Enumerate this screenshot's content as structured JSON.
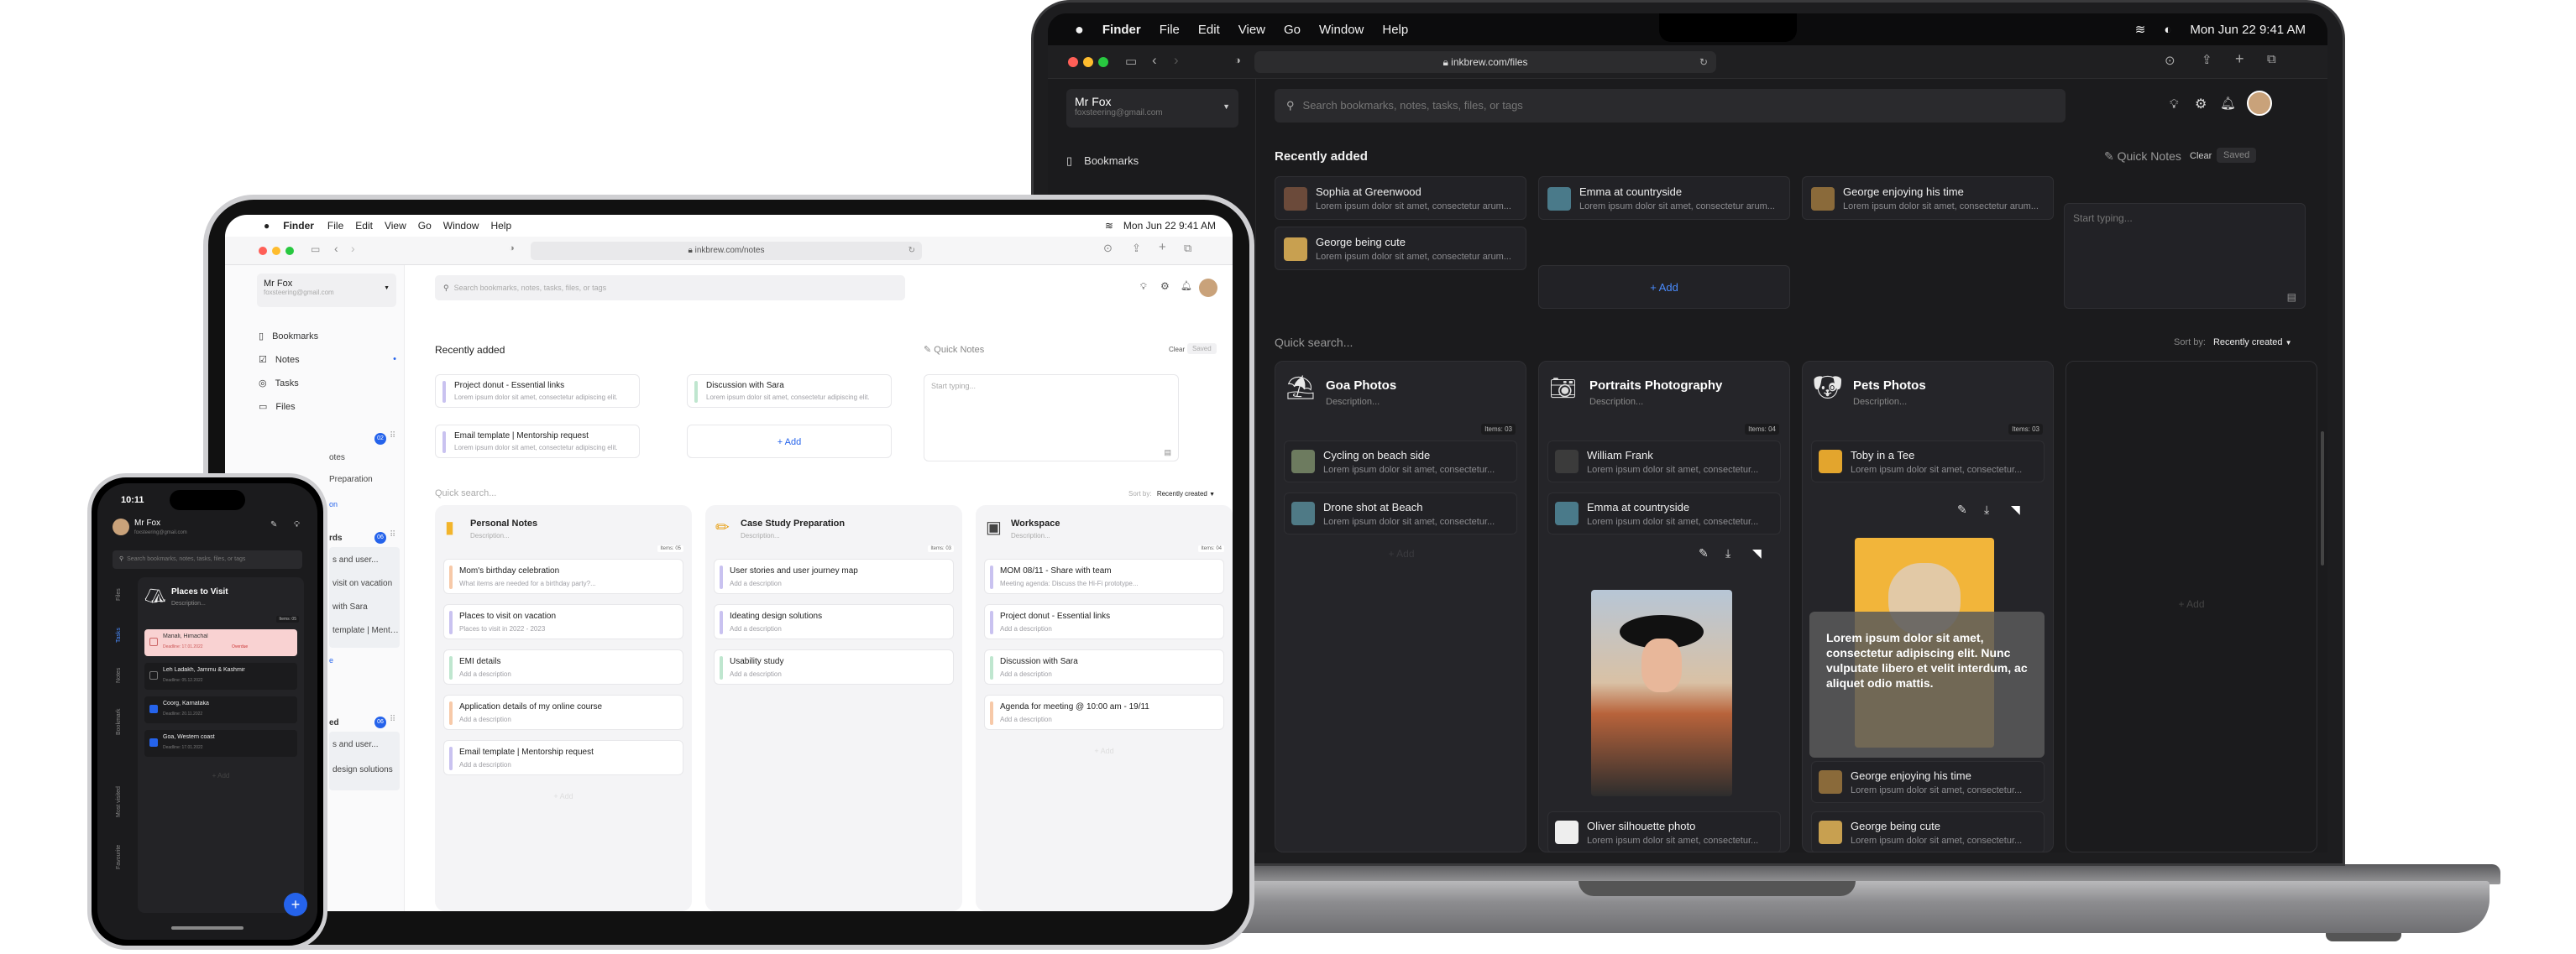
{
  "macbook": {
    "menubar": {
      "finder": "Finder",
      "items": [
        "File",
        "Edit",
        "View",
        "Go",
        "Window",
        "Help"
      ],
      "datetime": "Mon Jun 22  9:41 AM"
    },
    "url": "inkbrew.com/files",
    "user": {
      "name": "Mr Fox",
      "email": "foxsteering@gmail.com"
    },
    "sidebar": {
      "bookmarks": "Bookmarks"
    },
    "search": {
      "placeholder": "Search bookmarks, notes, tasks, files, or tags"
    },
    "recent": {
      "title": "Recently added",
      "items": [
        {
          "title": "Sophia at Greenwood",
          "desc": "Lorem ipsum dolor sit amet, consectetur arum...",
          "color": "#6b4a3a"
        },
        {
          "title": "Emma at countryside",
          "desc": "Lorem ipsum dolor sit amet, consectetur arum...",
          "color": "#4a7a8a"
        },
        {
          "title": "George enjoying his time",
          "desc": "Lorem ipsum dolor sit amet, consectetur arum...",
          "color": "#8a6a3a"
        },
        {
          "title": "George being cute",
          "desc": "Lorem ipsum dolor sit amet, consectetur arum...",
          "color": "#c8a050"
        }
      ],
      "add": "+ Add"
    },
    "quick_notes": {
      "title": "Quick Notes",
      "clear": "Clear",
      "saved": "Saved",
      "placeholder": "Start typing..."
    },
    "quick_search": "Quick search...",
    "sort": {
      "label": "Sort by:",
      "value": "Recently created"
    },
    "collections": [
      {
        "name": "Goa Photos",
        "desc": "Description...",
        "items": "Items: 03",
        "entries": [
          {
            "title": "Cycling on beach side",
            "desc": "Lorem ipsum dolor sit amet, consectetur..."
          },
          {
            "title": "Drone shot at Beach",
            "desc": "Lorem ipsum dolor sit amet, consectetur..."
          }
        ],
        "add": "+ Add"
      },
      {
        "name": "Portraits Photography",
        "desc": "Description...",
        "items": "Items: 04",
        "entries": [
          {
            "title": "William Frank",
            "desc": "Lorem ipsum dolor sit amet, consectetur..."
          },
          {
            "title": "Emma at countryside",
            "desc": "Lorem ipsum dolor sit amet, consectetur..."
          },
          {
            "title": "Oliver silhouette photo",
            "desc": "Lorem ipsum dolor sit amet, consectetur..."
          }
        ]
      },
      {
        "name": "Pets Photos",
        "desc": "Description...",
        "items": "Items: 03",
        "entries": [
          {
            "title": "Toby in a Tee",
            "desc": "Lorem ipsum dolor sit amet, consectetur..."
          },
          {
            "title": "George enjoying his time",
            "desc": "Lorem ipsum dolor sit amet, consectetur..."
          },
          {
            "title": "George being cute",
            "desc": "Lorem ipsum dolor sit amet, consectetur..."
          }
        ],
        "overlay": "Lorem ipsum dolor sit amet, consectetur adipiscing elit. Nunc vulputate libero et velit interdum, ac aliquet odio mattis."
      }
    ],
    "empty_add": "+ Add"
  },
  "ipad": {
    "menubar": {
      "finder": "Finder",
      "items": [
        "File",
        "Edit",
        "View",
        "Go",
        "Window",
        "Help"
      ],
      "datetime": "Mon Jun 22  9:41 AM"
    },
    "url": "inkbrew.com/notes",
    "user": {
      "name": "Mr Fox",
      "email": "foxsteering@gmail.com"
    },
    "sidebar": [
      "Bookmarks",
      "Notes",
      "Tasks",
      "Files"
    ],
    "sidebar_sections": [
      {
        "badge": "02",
        "rows": [
          "otes",
          "Preparation"
        ],
        "link": "on"
      },
      {
        "header": "rds",
        "badge": "06",
        "rows": [
          "s and user...",
          "visit on vacation",
          "with Sara",
          "template | Mentor..."
        ],
        "link": "e"
      },
      {
        "header": "ed",
        "badge": "06",
        "rows": [
          "s and user...",
          "design solutions"
        ]
      }
    ],
    "search": {
      "placeholder": "Search bookmarks, notes, tasks, files, or tags"
    },
    "recent": {
      "title": "Recently added",
      "items": [
        {
          "title": "Project donut - Essential links",
          "desc": "Lorem ipsum dolor sit amet, consectetur adipiscing elit.",
          "color": "#c9c2f0"
        },
        {
          "title": "Discussion with Sara",
          "desc": "Lorem ipsum dolor sit amet, consectetur adipiscing elit.",
          "color": "#bfe6cf"
        },
        {
          "title": "Email template | Mentorship request",
          "desc": "Lorem ipsum dolor sit amet, consectetur adipiscing elit.",
          "color": "#c9c2f0"
        }
      ],
      "add": "+ Add"
    },
    "quick_notes": {
      "title": "Quick Notes",
      "clear": "Clear",
      "saved": "Saved",
      "placeholder": "Start typing..."
    },
    "quick_search": "Quick search...",
    "sort": {
      "label": "Sort by:",
      "value": "Recently created"
    },
    "columns": [
      {
        "name": "Personal Notes",
        "desc": "Description...",
        "items": "Items: 05",
        "entries": [
          {
            "title": "Mom's birthday celebration",
            "desc": "What items are needed for a birthday party?...",
            "color": "#f7c9a8"
          },
          {
            "title": "Places to visit on vacation",
            "desc": "Places to visit in 2022 - 2023",
            "color": "#c9c2f0"
          },
          {
            "title": "EMI details",
            "desc": "Add a description",
            "color": "#bfe6cf"
          },
          {
            "title": "Application details of my online course",
            "desc": "Add a description",
            "color": "#f7c9a8"
          },
          {
            "title": "Email template | Mentorship request",
            "desc": "Add a description",
            "color": "#c9c2f0"
          }
        ],
        "add": "+ Add"
      },
      {
        "name": "Case Study Preparation",
        "desc": "Description...",
        "items": "Items: 03",
        "entries": [
          {
            "title": "User stories and user journey map",
            "desc": "Add a description",
            "color": "#c9c2f0"
          },
          {
            "title": "Ideating design solutions",
            "desc": "Add a description",
            "color": "#c9c2f0"
          },
          {
            "title": "Usability study",
            "desc": "Add a description",
            "color": "#bfe6cf"
          }
        ]
      },
      {
        "name": "Workspace",
        "desc": "Description...",
        "items": "Items: 04",
        "entries": [
          {
            "title": "MOM 08/11 - Share with team",
            "desc": "Meeting agenda: Discuss the Hi-Fi prototype...",
            "color": "#c9c2f0"
          },
          {
            "title": "Project donut - Essential links",
            "desc": "Add a description",
            "color": "#c9c2f0"
          },
          {
            "title": "Discussion with Sara",
            "desc": "Add a description",
            "color": "#bfe6cf"
          },
          {
            "title": "Agenda for meeting @ 10:00 am - 19/11",
            "desc": "Add a description",
            "color": "#f7c9a8"
          }
        ],
        "add": "+ Add"
      }
    ]
  },
  "iphone": {
    "time": "10:11",
    "user": {
      "name": "Mr Fox",
      "email": "foxsteering@gmail.com"
    },
    "search": {
      "placeholder": "Search bookmarks, notes, tasks, files, or tags"
    },
    "rail": [
      "Files",
      "Tasks",
      "Notes",
      "Bookmark",
      "Most visited",
      "Favourite"
    ],
    "card": {
      "title": "Places to Visit",
      "desc": "Description...",
      "items": "Items: 05"
    },
    "tasks": [
      {
        "title": "Manali, Himachal",
        "meta": "Deadline: 17.01.2022",
        "extra": "Overdue",
        "checked": false,
        "highlight": true
      },
      {
        "title": "Leh Ladakh, Jammu & Kashmir",
        "meta": "Deadline: 05.12.2022",
        "checked": false
      },
      {
        "title": "Coorg, Karnataka",
        "meta": "Deadline: 20.11.2022",
        "checked": true
      },
      {
        "title": "Goa, Western coast",
        "meta": "Deadline: 17.01.2022",
        "checked": true
      }
    ],
    "add": "+ Add"
  }
}
